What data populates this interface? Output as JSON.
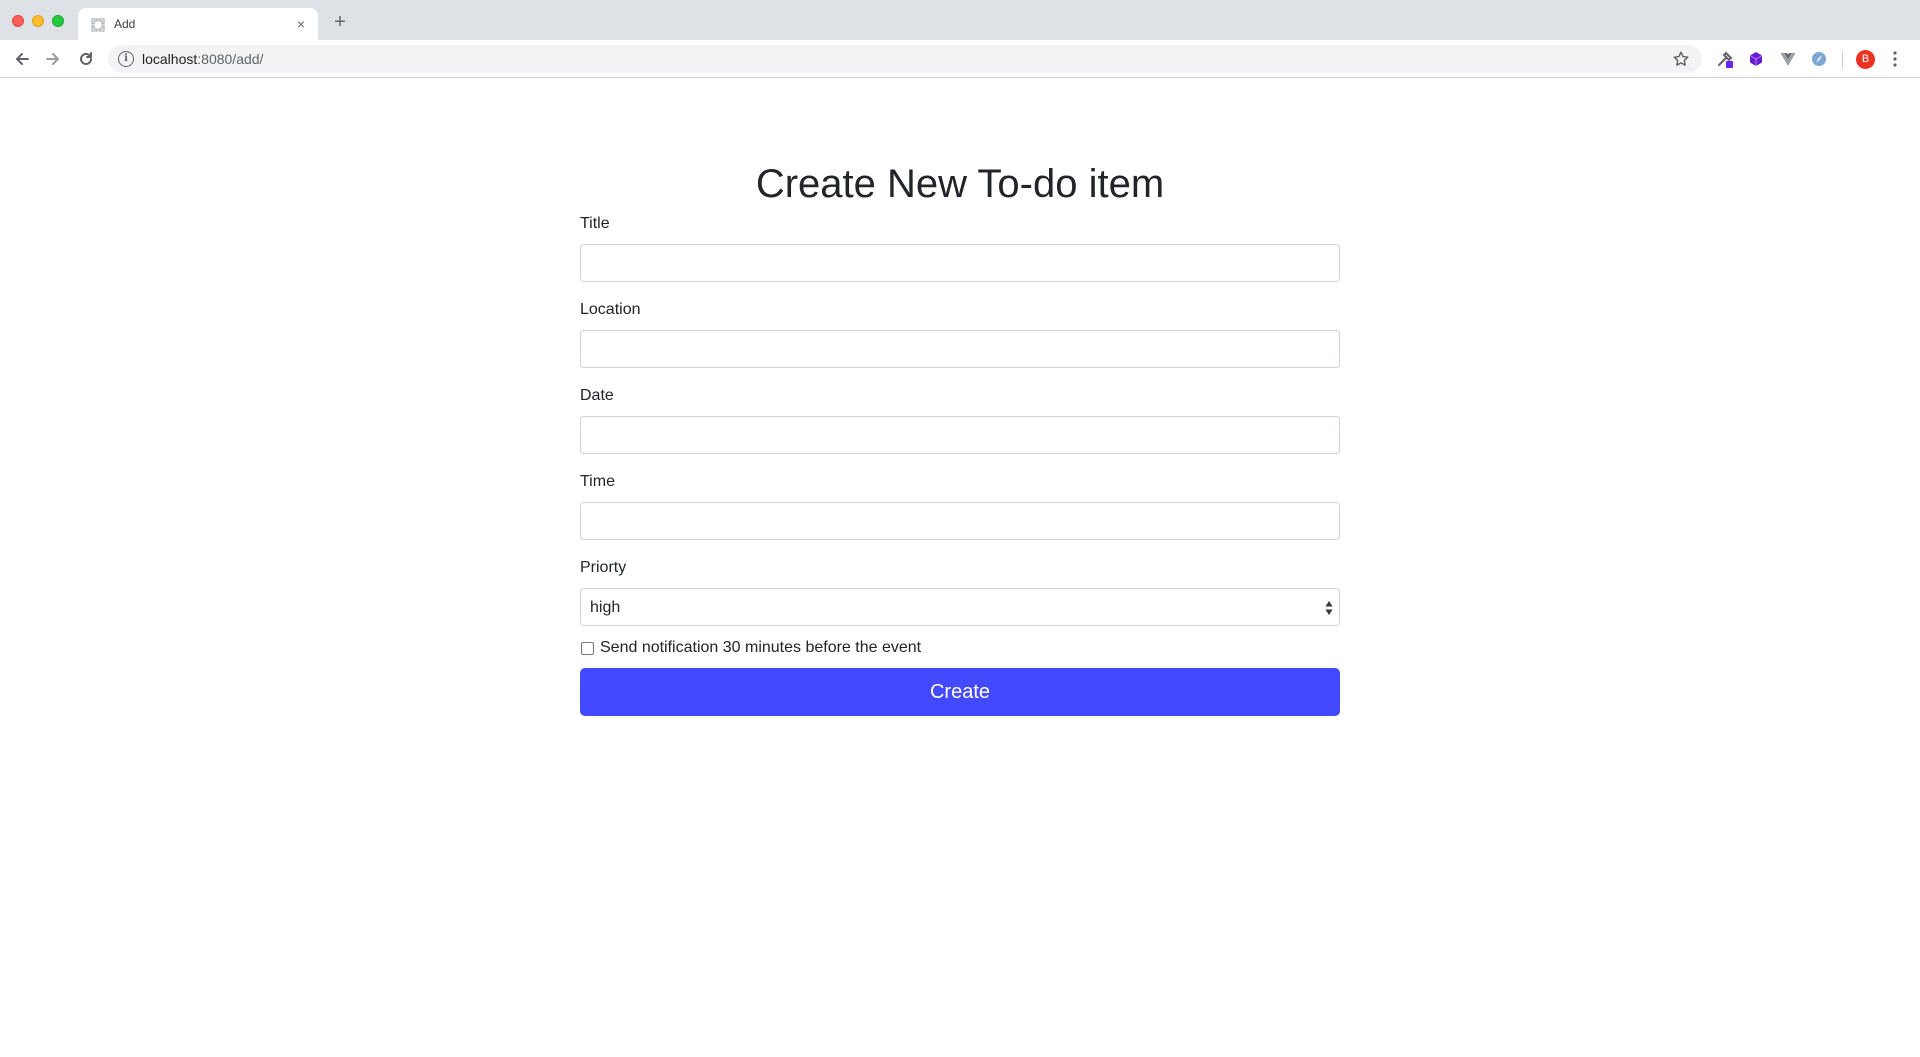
{
  "browser": {
    "tab": {
      "title": "Add",
      "favicon": "page-favicon-icon",
      "close_glyph": "×"
    },
    "new_tab_glyph": "+",
    "url": {
      "host": "localhost",
      "rest": ":8080/add/"
    },
    "profile_initial": "B",
    "icons": {
      "back": "arrow-left-icon",
      "forward": "arrow-right-icon",
      "reload": "reload-icon",
      "info": "info-icon",
      "bookmark": "star-icon",
      "menu": "more-vert-icon"
    },
    "colors": {
      "tabstrip": "#dee1e6",
      "omnibox": "#f1f3f4",
      "profile": "#ea3323"
    }
  },
  "form": {
    "heading": "Create New To-do item",
    "fields": {
      "title": {
        "label": "Title",
        "value": ""
      },
      "location": {
        "label": "Location",
        "value": ""
      },
      "date": {
        "label": "Date",
        "value": ""
      },
      "time": {
        "label": "Time",
        "value": ""
      }
    },
    "priority": {
      "label": "Priorty",
      "selected": "high"
    },
    "notification": {
      "label": "Send notification 30 minutes before the event",
      "checked": false
    },
    "submit_label": "Create",
    "accent_color": "#4349ff"
  }
}
